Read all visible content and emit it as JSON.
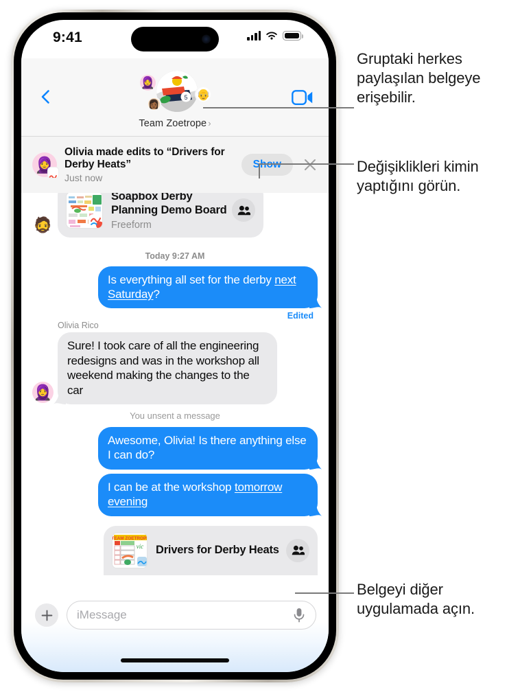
{
  "status_bar": {
    "time": "9:41",
    "signal_icon": "cellular-bars-icon",
    "wifi_icon": "wifi-icon",
    "battery_icon": "battery-icon"
  },
  "nav_bar": {
    "back_icon": "back-chevron-icon",
    "facetime_icon": "facetime-video-icon",
    "group_name": "Team Zoetrope",
    "group_chevron": "›",
    "avatars": [
      {
        "name": "avatar-group-main",
        "glyph": ""
      },
      {
        "name": "avatar-member-1",
        "glyph": "🧕"
      },
      {
        "name": "avatar-member-2",
        "glyph": "👴"
      },
      {
        "name": "avatar-member-3",
        "glyph": "👩🏾"
      }
    ]
  },
  "notification": {
    "avatar_icon": "olivia-avatar",
    "app_badge_icon": "freeform-app-icon",
    "title": "Olivia made edits to “Drivers for Derby Heats”",
    "subtitle": "Just now",
    "show_label": "Show",
    "close_icon": "close-icon"
  },
  "conversation": {
    "freeform_card": {
      "thumb_icon": "freeform-board-thumbnail",
      "badge_icon": "freeform-app-icon",
      "title": "Soapbox Derby Planning Demo Board",
      "subtitle": "Freeform",
      "people_icon": "people-shared-icon",
      "sender_avatar": "🧔"
    },
    "timestamp": "Today 9:27 AM",
    "messages": [
      {
        "id": "m1",
        "side": "out",
        "text_1": "Is everything all set for the derby ",
        "link": "next Saturday",
        "text_2": "?",
        "edited_label": "Edited"
      },
      {
        "id": "m2",
        "side": "in",
        "sender": "Olivia Rico",
        "avatar": "🧕",
        "text": "Sure! I took care of all the engineering redesigns and was in the workshop all weekend making the changes to the car"
      },
      {
        "id": "m3",
        "side": "out",
        "text": "Awesome, Olivia! Is there anything else I can do?"
      },
      {
        "id": "m4",
        "side": "out",
        "text_1": "I can be at the workshop ",
        "link": "tomorrow evening",
        "text_2": ""
      }
    ],
    "system_note": "You unsent a message",
    "doc_card": {
      "thumb_icon": "derby-heats-document-thumbnail",
      "title": "Drivers for Derby Heats",
      "people_icon": "people-shared-icon"
    }
  },
  "input_bar": {
    "plus_icon": "plus-icon",
    "placeholder": "iMessage",
    "value": "",
    "mic_icon": "microphone-icon"
  },
  "annotations": {
    "a1": "Gruptaki herkes paylaşılan belgeye erişebilir.",
    "a2": "Değişiklikleri kimin yaptığını görün.",
    "a3": "Belgeyi diğer uygulamada açın."
  },
  "colors": {
    "imessage_blue": "#1b8cf9",
    "action_blue": "#0a84ff",
    "gray_bubble": "#e9e9eb",
    "leader_line": "#7a7a7a"
  }
}
